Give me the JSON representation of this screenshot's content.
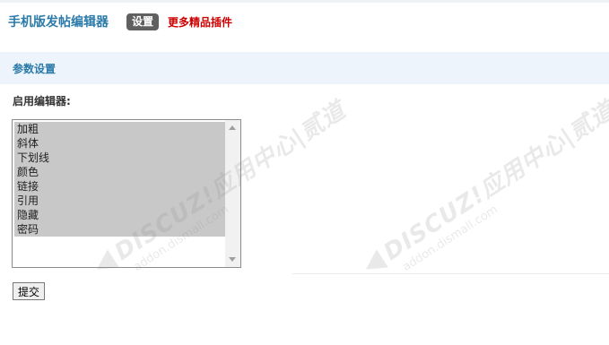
{
  "header": {
    "title": "手机版发帖编辑器",
    "settings_tab": "设置",
    "more_plugins": "更多精品插件"
  },
  "section": {
    "title": "参数设置"
  },
  "form": {
    "editor_label": "启用编辑器:",
    "options": [
      {
        "label": "加粗",
        "selected": true
      },
      {
        "label": "斜体",
        "selected": true
      },
      {
        "label": "下划线",
        "selected": true
      },
      {
        "label": "颜色",
        "selected": true
      },
      {
        "label": "链接",
        "selected": true
      },
      {
        "label": "引用",
        "selected": true
      },
      {
        "label": "隐藏",
        "selected": true
      },
      {
        "label": "密码",
        "selected": true
      }
    ],
    "submit_label": "提交"
  },
  "watermark": {
    "brand": "DISCUZ!应用中心",
    "vendor": "贰道",
    "url": "addon.dismall.com"
  }
}
